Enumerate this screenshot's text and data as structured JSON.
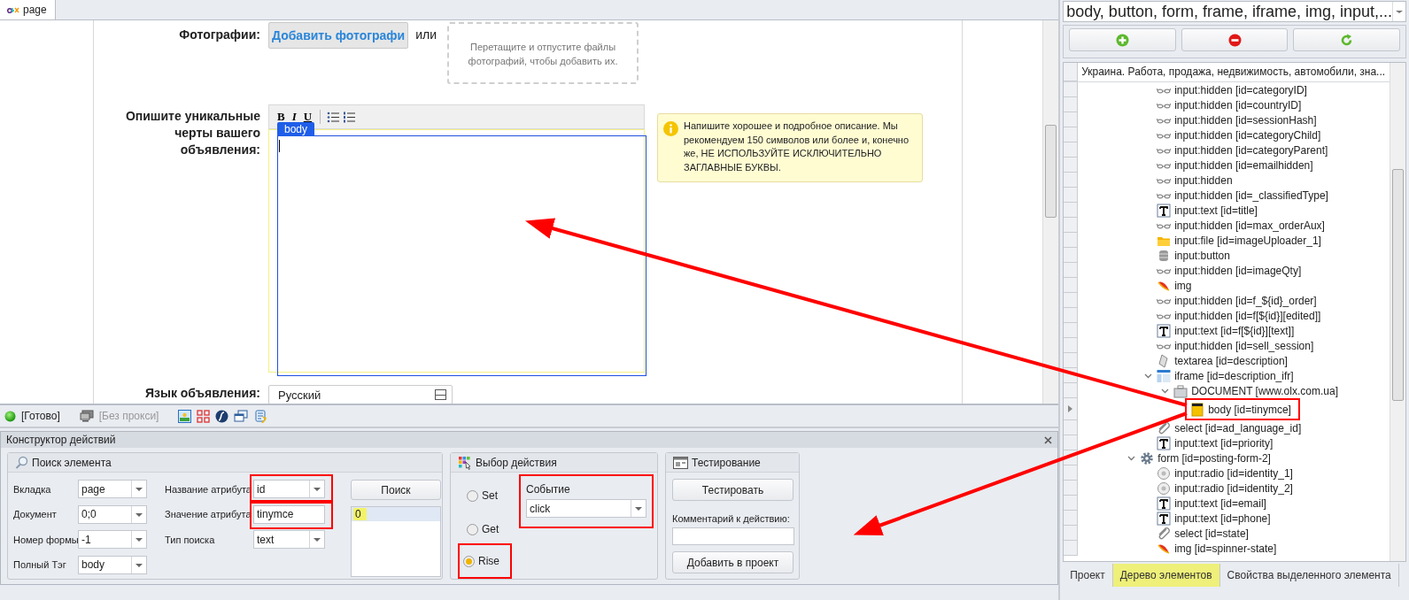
{
  "browser_tab": {
    "label": "page",
    "selected": true
  },
  "web_form": {
    "photos": {
      "label": "Фотографии:",
      "button": "Добавить фотографи",
      "or": "или",
      "dropzone": "Перетащите и отпустите файлы фотографий, чтобы добавить их."
    },
    "description": {
      "label": "Опишите уникальные черты вашего объявления:",
      "toolbar": [
        "B",
        "I",
        "U"
      ],
      "element_tag": "body",
      "tip": "Напишите хорошее и подробное описание. Мы рекомендуем 150 символов или более и, конечно же, НЕ ИСПОЛЬЗУЙТЕ ИСКЛЮЧИТЕЛЬНО ЗАГЛАВНЫЕ БУКВЫ."
    },
    "language": {
      "label": "Язык объявления:",
      "value": "Русский"
    }
  },
  "status_bar": {
    "state": "[Готово]",
    "proxy": "[Без прокси]"
  },
  "constructor": {
    "title": "Конструктор действий",
    "search": {
      "title": "Поиск элемента",
      "left_fields": [
        {
          "label": "Вкладка",
          "value": "page",
          "kind": "select"
        },
        {
          "label": "Документ",
          "value": "0;0",
          "kind": "select"
        },
        {
          "label": "Номер формы",
          "value": "-1",
          "kind": "select"
        },
        {
          "label": "Полный Тэг",
          "value": "body",
          "kind": "select"
        }
      ],
      "right_fields": [
        {
          "label": "Название атрибута",
          "value": "id",
          "kind": "select"
        },
        {
          "label": "Значение атрибута",
          "value": "tinymce",
          "kind": "input"
        },
        {
          "label": "Тип поиска",
          "value": "text",
          "kind": "select"
        }
      ],
      "button": "Поиск",
      "results": [
        {
          "text": "0",
          "selected": true
        }
      ]
    },
    "action": {
      "title": "Выбор действия",
      "options": [
        {
          "label": "Set",
          "selected": false
        },
        {
          "label": "Get",
          "selected": false
        },
        {
          "label": "Rise",
          "selected": true
        }
      ],
      "event_label": "Событие",
      "event_value": "click"
    },
    "testing": {
      "title": "Тестирование",
      "test_button": "Тестировать",
      "comment_label": "Комментарий к действию:",
      "add_button": "Добавить в проект"
    }
  },
  "filter": {
    "value": "body, button, form, frame, iframe, img, input,..."
  },
  "element_tree": {
    "header": "Украина. Работа, продажа, недвижимость, автомобили, зна...",
    "groups": [
      {
        "children": [
          {
            "label": "input:hidden [id=categoryID]",
            "kind": "hidden"
          },
          {
            "label": "input:hidden [id=countryID]",
            "kind": "hidden"
          },
          {
            "label": "input:hidden [id=sessionHash]",
            "kind": "hidden"
          },
          {
            "label": "input:hidden [id=categoryChild]",
            "kind": "hidden"
          },
          {
            "label": "input:hidden [id=categoryParent]",
            "kind": "hidden"
          },
          {
            "label": "input:hidden [id=emailhidden]",
            "kind": "hidden"
          },
          {
            "label": "input:hidden",
            "kind": "hidden"
          },
          {
            "label": "input:hidden [id=_classifiedType]",
            "kind": "hidden"
          },
          {
            "label": "input:text [id=title]",
            "kind": "text"
          },
          {
            "label": "input:hidden [id=max_orderAux]",
            "kind": "hidden"
          },
          {
            "label": "input:file [id=imageUploader_1]",
            "kind": "file"
          },
          {
            "label": "input:button",
            "kind": "button"
          },
          {
            "label": "input:hidden [id=imageQty]",
            "kind": "hidden"
          },
          {
            "label": "img",
            "kind": "img"
          },
          {
            "label": "input:hidden [id=f_${id}_order]",
            "kind": "hidden"
          },
          {
            "label": "input:hidden [id=f[${id}][edited]]",
            "kind": "hidden"
          },
          {
            "label": "input:text [id=f[${id}][text]]",
            "kind": "text"
          },
          {
            "label": "input:hidden [id=sell_session]",
            "kind": "hidden"
          },
          {
            "label": "textarea [id=description]",
            "kind": "textarea"
          },
          {
            "label": "iframe [id=description_ifr]",
            "kind": "iframe",
            "expanded": true,
            "children": [
              {
                "label": "DOCUMENT [www.olx.com.ua]",
                "kind": "document",
                "expanded": true,
                "children": [
                  {
                    "label": "body [id=tinymce]",
                    "kind": "body",
                    "current": true
                  }
                ]
              }
            ]
          },
          {
            "label": "select [id=ad_language_id]",
            "kind": "select"
          },
          {
            "label": "input:text [id=priority]",
            "kind": "text"
          }
        ]
      },
      {
        "label": "form [id=posting-form-2]",
        "kind": "form",
        "expanded": true,
        "children": [
          {
            "label": "input:radio [id=identity_1]",
            "kind": "radio"
          },
          {
            "label": "input:radio [id=identity_2]",
            "kind": "radio"
          },
          {
            "label": "input:text [id=email]",
            "kind": "text"
          },
          {
            "label": "input:text [id=phone]",
            "kind": "text"
          },
          {
            "label": "select [id=state]",
            "kind": "select"
          },
          {
            "label": "img [id=spinner-state]",
            "kind": "img"
          }
        ]
      }
    ]
  },
  "panel_tabs": [
    {
      "label": "Проект",
      "selected": false
    },
    {
      "label": "Дерево элементов",
      "selected": true
    },
    {
      "label": "Свойства выделенного элемента",
      "selected": false
    }
  ]
}
